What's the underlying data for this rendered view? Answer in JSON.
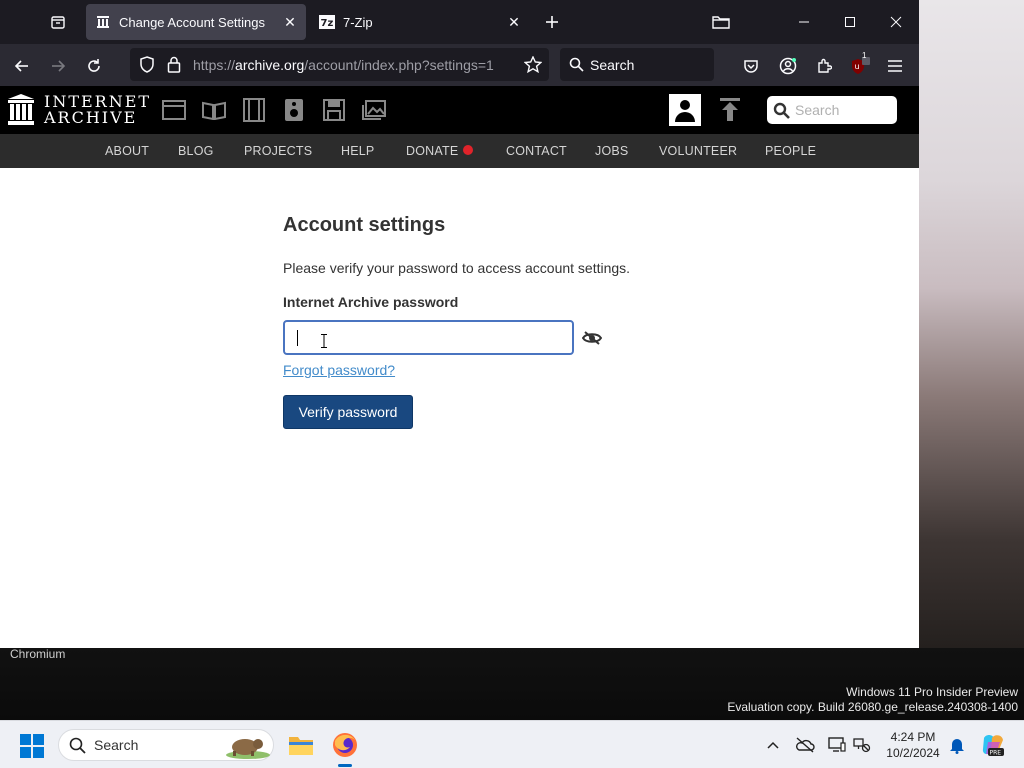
{
  "browser": {
    "tabs": [
      {
        "title": "Change Account Settings",
        "active": true,
        "icon": "archive-icon"
      },
      {
        "title": "7-Zip",
        "active": false,
        "icon": "7zip-icon"
      }
    ],
    "url": {
      "prefix": "https://",
      "host": "archive.org",
      "path": "/account/index.php?settings=1"
    },
    "search_placeholder": "Search"
  },
  "ia_header": {
    "logo_line1": "INTERNET",
    "logo_line2": "ARCHIVE",
    "search_placeholder": "Search"
  },
  "ia_subnav": [
    "ABOUT",
    "BLOG",
    "PROJECTS",
    "HELP",
    "DONATE",
    "CONTACT",
    "JOBS",
    "VOLUNTEER",
    "PEOPLE"
  ],
  "main": {
    "title": "Account settings",
    "instruction": "Please verify your password to access account settings.",
    "password_label": "Internet Archive password",
    "password_value": "",
    "forgot_link": "Forgot password?",
    "verify_button": "Verify password"
  },
  "desktop": {
    "window_label": "Chromium",
    "watermark_line1": "Windows 11 Pro Insider Preview",
    "watermark_line2": "Evaluation copy. Build 26080.ge_release.240308-1400"
  },
  "taskbar": {
    "search_label": "Search",
    "time": "4:24 PM",
    "date": "10/2/2024",
    "extension_badge": "1"
  },
  "colors": {
    "titlebar": "#1c1b22",
    "navbar": "#2b2a33",
    "ia_header": "#000000",
    "ia_subnav": "#2c2c2c",
    "verify_button": "#194880",
    "link": "#428bca",
    "input_focus": "#4a74c0",
    "donate_heart": "#e0232a"
  }
}
